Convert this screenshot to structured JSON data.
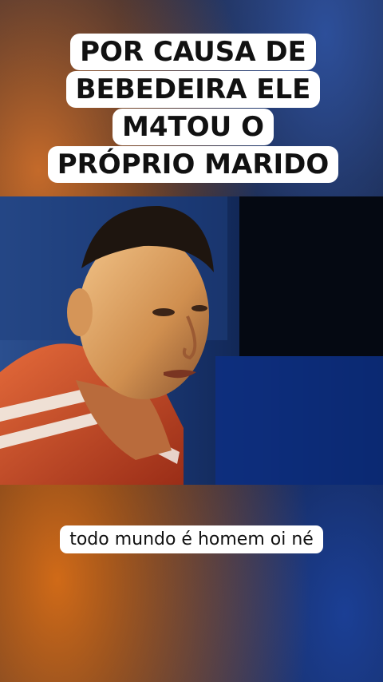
{
  "headline": {
    "text": "POR CAUSA DE BEBEDEIRA ELE M4TOU O PRÓPRIO MARIDO"
  },
  "caption": {
    "text": "todo mundo é homem oi né"
  },
  "colors": {
    "label_bg": "#ffffff",
    "label_text": "#111111",
    "orange_glow": "#c46a2a",
    "blue_glow": "#1b3f95"
  }
}
